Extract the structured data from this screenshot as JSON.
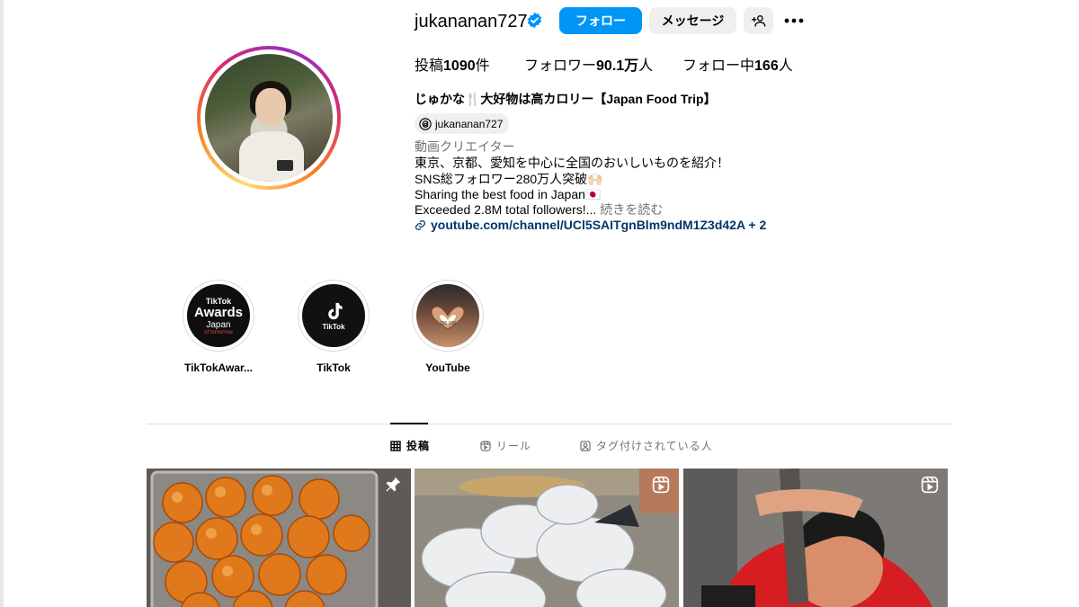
{
  "profile": {
    "username": "jukananan727",
    "follow_label": "フォロー",
    "message_label": "メッセージ",
    "stats": {
      "posts_prefix": "投稿",
      "posts_value": "1090",
      "posts_suffix": "件",
      "followers_prefix": "フォロワー",
      "followers_value": "90.1万",
      "followers_suffix": "人",
      "following_prefix": "フォロー中",
      "following_value": "166",
      "following_suffix": "人"
    },
    "full_name": "じゅかな🍴大好物は高カロリー【Japan Food Trip】",
    "threads_handle": "jukananan727",
    "category": "動画クリエイター",
    "bio_lines": [
      "東京、京都、愛知を中心に全国のおいしいものを紹介！",
      "SNS総フォロワー280万人突破🙌🏻",
      "Sharing the best food in Japan🇯🇵",
      "Exceeded 2.8M total followers!..."
    ],
    "more_label": "続きを読む",
    "link_text": "youtube.com/channel/UCl5SAITgnBlm9ndM1Z3d42A + 2"
  },
  "highlights": [
    {
      "label": "TikTokAwar...",
      "line1": "TikTok",
      "line2": "Awards",
      "line3": "Japan",
      "line4": "of tomorrow"
    },
    {
      "label": "TikTok",
      "line1": "TikTok"
    },
    {
      "label": "YouTube",
      "line1": "100,000"
    }
  ],
  "tabs": [
    {
      "label": "投稿",
      "active": true
    },
    {
      "label": "リール",
      "active": false
    },
    {
      "label": "タグ付けされている人",
      "active": false
    }
  ],
  "colors": {
    "accent": "#0095f6",
    "link": "#00376b",
    "secondary_text": "#737373",
    "button_bg": "#efefef"
  }
}
